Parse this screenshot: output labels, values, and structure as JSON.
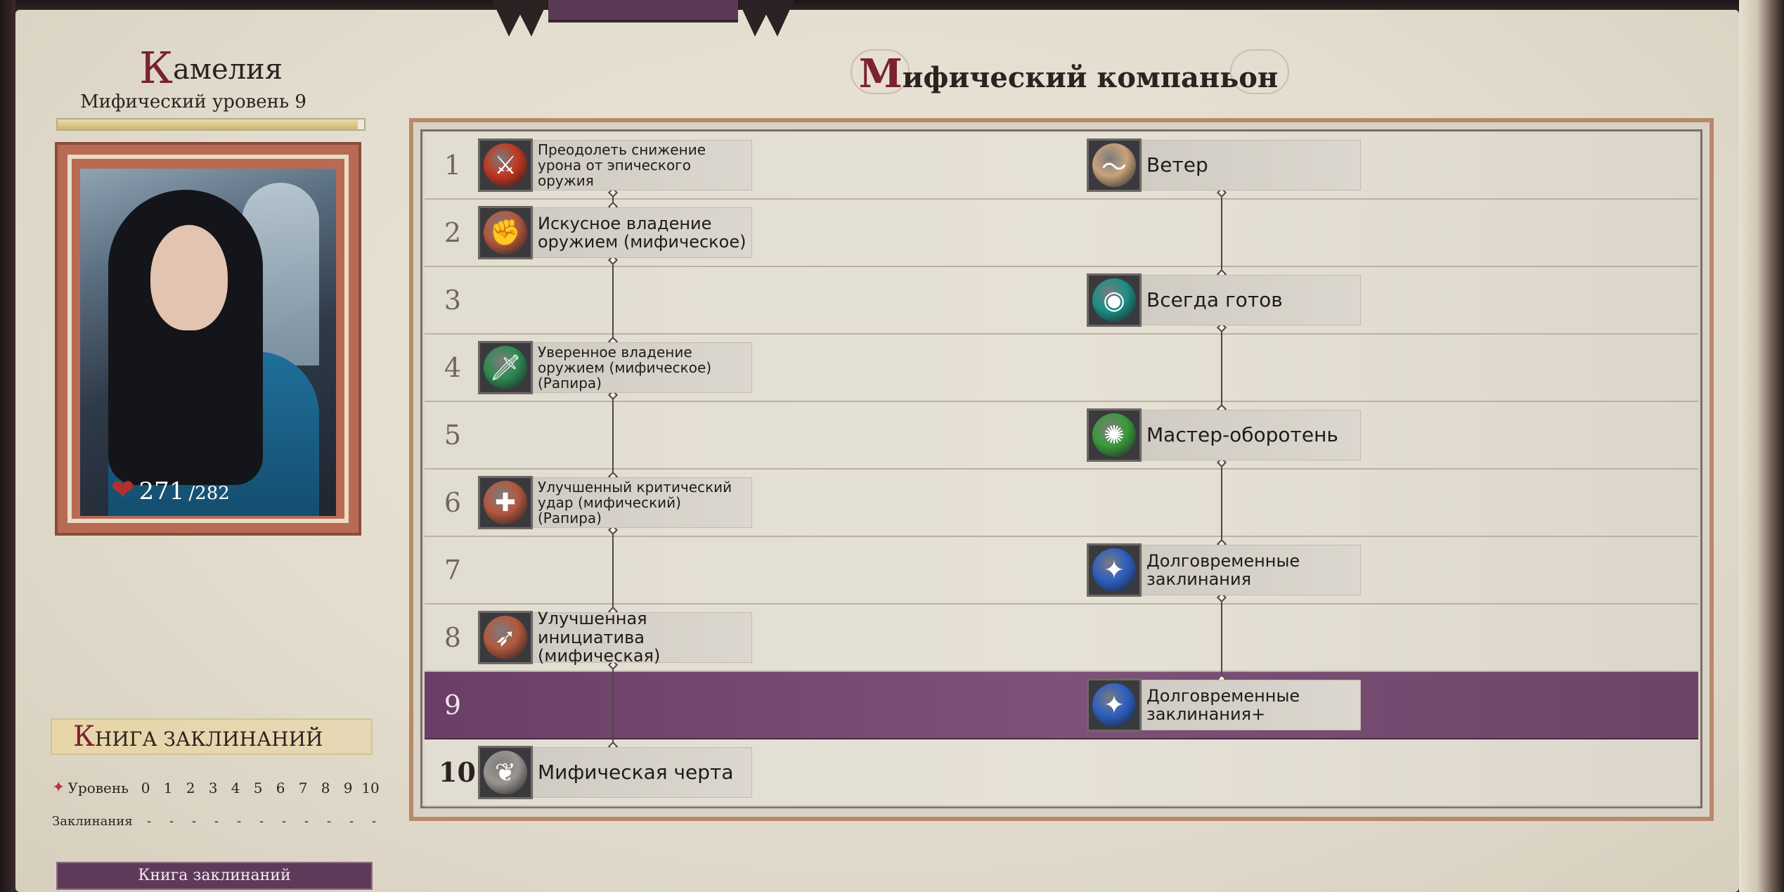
{
  "character": {
    "name_cap": "К",
    "name_rest": "амелия",
    "mythic_level": "Мифический уровень 9",
    "xp_fraction": 0.98,
    "hp_current": "271",
    "hp_max": "/282"
  },
  "header": {
    "title_cap": "М",
    "title_rest": "ифический компаньон"
  },
  "rows": [
    "1",
    "2",
    "3",
    "4",
    "5",
    "6",
    "7",
    "8",
    "9",
    "10"
  ],
  "selected_row": "9",
  "left_column": [
    {
      "row": "1",
      "label": "Преодолеть снижение урона от эпического оружия",
      "icon": "weapon-slash-icon",
      "color": "#c0381f"
    },
    {
      "row": "2",
      "label": "Искусное владение оружием (мифическое)",
      "icon": "weapon-focus-icon",
      "color": "#b3583d"
    },
    {
      "row": "4",
      "label": "Уверенное владение оружием (мифическое) (Рапира)",
      "icon": "sword-icon",
      "color": "#2f8a52"
    },
    {
      "row": "6",
      "label": "Улучшенный критический удар (мифический) (Рапира)",
      "icon": "critical-heart-icon",
      "color": "#b3583d"
    },
    {
      "row": "8",
      "label": "Улучшенная инициатива (мифическая)",
      "icon": "initiative-icon",
      "color": "#b3583d"
    },
    {
      "row": "10",
      "label": "Мифическая черта",
      "icon": "winged-icon",
      "color": "#9a9590"
    }
  ],
  "right_column": [
    {
      "row": "1",
      "label": "Ветер",
      "icon": "wind-icon",
      "color": "#c8a27a"
    },
    {
      "row": "3",
      "label": "Всегда готов",
      "icon": "eye-claw-icon",
      "color": "#1b8f86"
    },
    {
      "row": "5",
      "label": "Мастер-оборотень",
      "icon": "wolf-icon",
      "color": "#3b9a3b"
    },
    {
      "row": "7",
      "label": "Долговременные заклинания",
      "icon": "extend-spell-icon",
      "color": "#2d5fc0"
    },
    {
      "row": "9",
      "label": "Долговременные заклинания+",
      "icon": "extend-spell-plus-icon",
      "color": "#2d5fc0"
    }
  ],
  "spellbook": {
    "heading_cap": "К",
    "heading_rest": "НИГА ЗАКЛИНАНИЙ",
    "level_label": "Уровень",
    "levels": [
      "0",
      "1",
      "2",
      "3",
      "4",
      "5",
      "6",
      "7",
      "8",
      "9",
      "10"
    ],
    "spells_label": "Заклинания",
    "spell_counts": [
      "-",
      "-",
      "-",
      "-",
      "-",
      "-",
      "-",
      "-",
      "-",
      "-",
      "-"
    ],
    "button_label": "Книга заклинаний"
  }
}
